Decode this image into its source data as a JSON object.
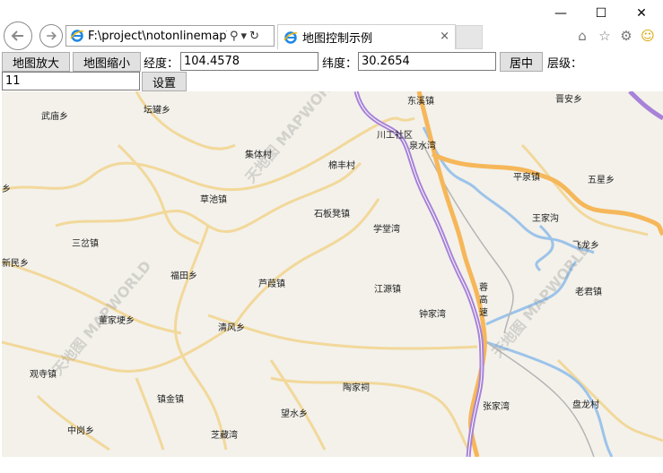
{
  "window": {
    "minimize": "—",
    "maximize": "☐",
    "close": "✕"
  },
  "nav": {
    "back_icon": "arrow-left-icon",
    "forward_icon": "arrow-right-icon"
  },
  "address": {
    "url": "F:\\project\\notonlinemap\\m",
    "search_icon": "⚲",
    "dropdown_icon": "▾",
    "refresh_icon": "↻"
  },
  "tab": {
    "title": "地图控制示例",
    "close": "×"
  },
  "toolbar_icons": {
    "home": "⌂",
    "favorites": "☆",
    "settings": "⚙",
    "smiley": "☺"
  },
  "controls": {
    "zoom_in_label": "地图放大",
    "zoom_out_label": "地图缩小",
    "lng_label": "经度：",
    "lng_value": "104.4578",
    "lat_label": "纬度：",
    "lat_value": "30.2654",
    "center_label": "居中",
    "level_label": "层级：",
    "level_value": "11",
    "set_label": "设置"
  },
  "map": {
    "watermark": "天地图 MAPWORLD",
    "places": [
      {
        "name": "武庙乡"
      },
      {
        "name": "坛罐乡"
      },
      {
        "name": "东溪镇"
      },
      {
        "name": "晋安乡"
      },
      {
        "name": "川工社区"
      },
      {
        "name": "泉水湾"
      },
      {
        "name": "集体村"
      },
      {
        "name": "棉丰村"
      },
      {
        "name": "平泉镇"
      },
      {
        "name": "五星乡"
      },
      {
        "name": "乡"
      },
      {
        "name": "草池镇"
      },
      {
        "name": "石板凳镇"
      },
      {
        "name": "王家沟"
      },
      {
        "name": "学堂湾"
      },
      {
        "name": "飞龙乡"
      },
      {
        "name": "三岔镇"
      },
      {
        "name": "新民乡"
      },
      {
        "name": "福田乡"
      },
      {
        "name": "芦葭镇"
      },
      {
        "name": "江源镇"
      },
      {
        "name": "老君镇"
      },
      {
        "name": "蓉"
      },
      {
        "name": "高"
      },
      {
        "name": "速"
      },
      {
        "name": "钟家湾"
      },
      {
        "name": "董家埂乡"
      },
      {
        "name": "清风乡"
      },
      {
        "name": "观寺镇"
      },
      {
        "name": "陶家祠"
      },
      {
        "name": "镇金镇"
      },
      {
        "name": "张家湾"
      },
      {
        "name": "盘龙村"
      },
      {
        "name": "望水乡"
      },
      {
        "name": "中岗乡"
      },
      {
        "name": "芝藏湾"
      }
    ]
  },
  "colors": {
    "map_bg": "#f3f1ea",
    "highway": "#a782d8",
    "major_road": "#f6b75a",
    "minor_road": "#f2d89a",
    "river": "#9cc3ea"
  }
}
